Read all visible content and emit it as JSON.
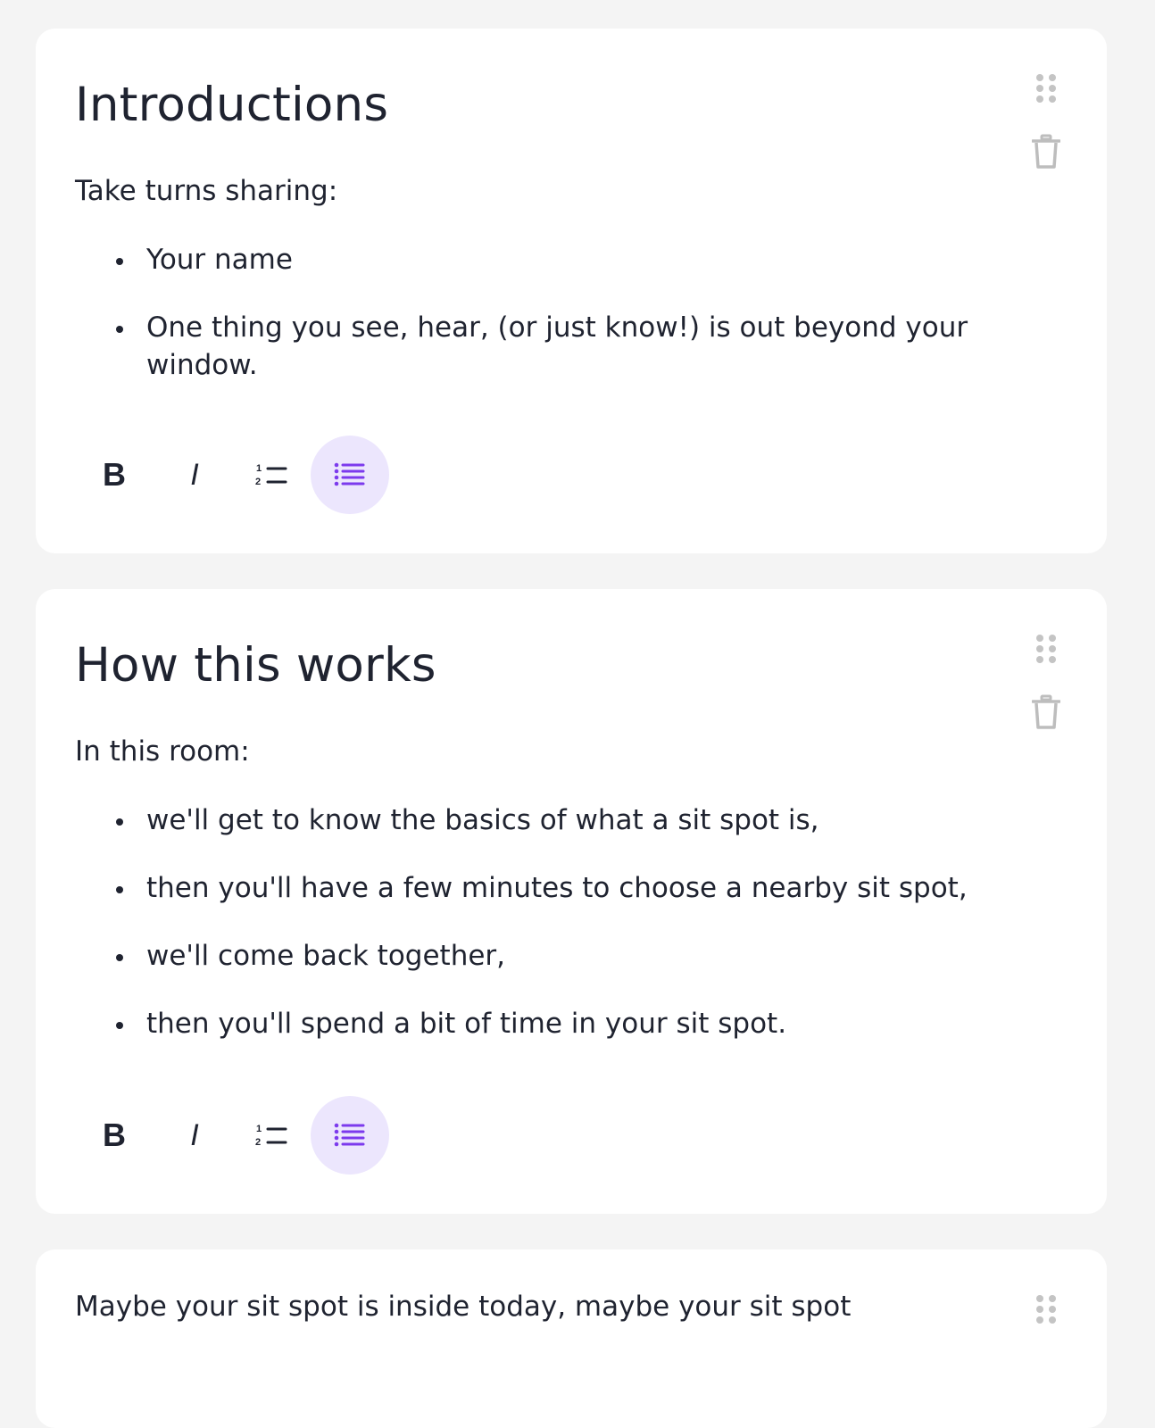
{
  "cards": [
    {
      "title": "Introductions",
      "lead": "Take turns sharing:",
      "bullets": [
        "Your name",
        "One thing you see, hear, (or just know!) is out beyond your window."
      ]
    },
    {
      "title": "How this works",
      "lead": "In this room:",
      "bullets": [
        "we'll get to know the basics of what a sit spot is,",
        "then you'll have a few minutes to choose a nearby sit spot,",
        "we'll come back together,",
        "then you'll spend a bit of time in your sit spot."
      ]
    },
    {
      "lead": "Maybe your sit spot is inside today, maybe your sit spot"
    }
  ],
  "toolbar": {
    "bold_label": "B",
    "italic_label": "I",
    "active_tool": "bullet-list",
    "active_color": "#7c3aed",
    "active_bg": "#ece6fd"
  },
  "icons": {
    "drag": "drag-handle-icon",
    "delete": "trash-icon",
    "numbered_list": "numbered-list-icon",
    "bullet_list": "bullet-list-icon"
  }
}
